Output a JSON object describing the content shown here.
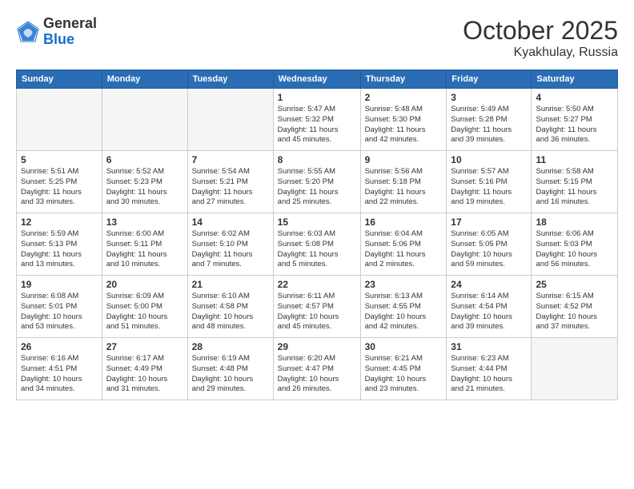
{
  "header": {
    "logo": {
      "line1": "General",
      "line2": "Blue"
    },
    "month": "October 2025",
    "location": "Kyakhulay, Russia"
  },
  "days_of_week": [
    "Sunday",
    "Monday",
    "Tuesday",
    "Wednesday",
    "Thursday",
    "Friday",
    "Saturday"
  ],
  "weeks": [
    [
      {
        "day": "",
        "info": ""
      },
      {
        "day": "",
        "info": ""
      },
      {
        "day": "",
        "info": ""
      },
      {
        "day": "1",
        "info": "Sunrise: 5:47 AM\nSunset: 5:32 PM\nDaylight: 11 hours\nand 45 minutes."
      },
      {
        "day": "2",
        "info": "Sunrise: 5:48 AM\nSunset: 5:30 PM\nDaylight: 11 hours\nand 42 minutes."
      },
      {
        "day": "3",
        "info": "Sunrise: 5:49 AM\nSunset: 5:28 PM\nDaylight: 11 hours\nand 39 minutes."
      },
      {
        "day": "4",
        "info": "Sunrise: 5:50 AM\nSunset: 5:27 PM\nDaylight: 11 hours\nand 36 minutes."
      }
    ],
    [
      {
        "day": "5",
        "info": "Sunrise: 5:51 AM\nSunset: 5:25 PM\nDaylight: 11 hours\nand 33 minutes."
      },
      {
        "day": "6",
        "info": "Sunrise: 5:52 AM\nSunset: 5:23 PM\nDaylight: 11 hours\nand 30 minutes."
      },
      {
        "day": "7",
        "info": "Sunrise: 5:54 AM\nSunset: 5:21 PM\nDaylight: 11 hours\nand 27 minutes."
      },
      {
        "day": "8",
        "info": "Sunrise: 5:55 AM\nSunset: 5:20 PM\nDaylight: 11 hours\nand 25 minutes."
      },
      {
        "day": "9",
        "info": "Sunrise: 5:56 AM\nSunset: 5:18 PM\nDaylight: 11 hours\nand 22 minutes."
      },
      {
        "day": "10",
        "info": "Sunrise: 5:57 AM\nSunset: 5:16 PM\nDaylight: 11 hours\nand 19 minutes."
      },
      {
        "day": "11",
        "info": "Sunrise: 5:58 AM\nSunset: 5:15 PM\nDaylight: 11 hours\nand 16 minutes."
      }
    ],
    [
      {
        "day": "12",
        "info": "Sunrise: 5:59 AM\nSunset: 5:13 PM\nDaylight: 11 hours\nand 13 minutes."
      },
      {
        "day": "13",
        "info": "Sunrise: 6:00 AM\nSunset: 5:11 PM\nDaylight: 11 hours\nand 10 minutes."
      },
      {
        "day": "14",
        "info": "Sunrise: 6:02 AM\nSunset: 5:10 PM\nDaylight: 11 hours\nand 7 minutes."
      },
      {
        "day": "15",
        "info": "Sunrise: 6:03 AM\nSunset: 5:08 PM\nDaylight: 11 hours\nand 5 minutes."
      },
      {
        "day": "16",
        "info": "Sunrise: 6:04 AM\nSunset: 5:06 PM\nDaylight: 11 hours\nand 2 minutes."
      },
      {
        "day": "17",
        "info": "Sunrise: 6:05 AM\nSunset: 5:05 PM\nDaylight: 10 hours\nand 59 minutes."
      },
      {
        "day": "18",
        "info": "Sunrise: 6:06 AM\nSunset: 5:03 PM\nDaylight: 10 hours\nand 56 minutes."
      }
    ],
    [
      {
        "day": "19",
        "info": "Sunrise: 6:08 AM\nSunset: 5:01 PM\nDaylight: 10 hours\nand 53 minutes."
      },
      {
        "day": "20",
        "info": "Sunrise: 6:09 AM\nSunset: 5:00 PM\nDaylight: 10 hours\nand 51 minutes."
      },
      {
        "day": "21",
        "info": "Sunrise: 6:10 AM\nSunset: 4:58 PM\nDaylight: 10 hours\nand 48 minutes."
      },
      {
        "day": "22",
        "info": "Sunrise: 6:11 AM\nSunset: 4:57 PM\nDaylight: 10 hours\nand 45 minutes."
      },
      {
        "day": "23",
        "info": "Sunrise: 6:13 AM\nSunset: 4:55 PM\nDaylight: 10 hours\nand 42 minutes."
      },
      {
        "day": "24",
        "info": "Sunrise: 6:14 AM\nSunset: 4:54 PM\nDaylight: 10 hours\nand 39 minutes."
      },
      {
        "day": "25",
        "info": "Sunrise: 6:15 AM\nSunset: 4:52 PM\nDaylight: 10 hours\nand 37 minutes."
      }
    ],
    [
      {
        "day": "26",
        "info": "Sunrise: 6:16 AM\nSunset: 4:51 PM\nDaylight: 10 hours\nand 34 minutes."
      },
      {
        "day": "27",
        "info": "Sunrise: 6:17 AM\nSunset: 4:49 PM\nDaylight: 10 hours\nand 31 minutes."
      },
      {
        "day": "28",
        "info": "Sunrise: 6:19 AM\nSunset: 4:48 PM\nDaylight: 10 hours\nand 29 minutes."
      },
      {
        "day": "29",
        "info": "Sunrise: 6:20 AM\nSunset: 4:47 PM\nDaylight: 10 hours\nand 26 minutes."
      },
      {
        "day": "30",
        "info": "Sunrise: 6:21 AM\nSunset: 4:45 PM\nDaylight: 10 hours\nand 23 minutes."
      },
      {
        "day": "31",
        "info": "Sunrise: 6:23 AM\nSunset: 4:44 PM\nDaylight: 10 hours\nand 21 minutes."
      },
      {
        "day": "",
        "info": ""
      }
    ]
  ]
}
